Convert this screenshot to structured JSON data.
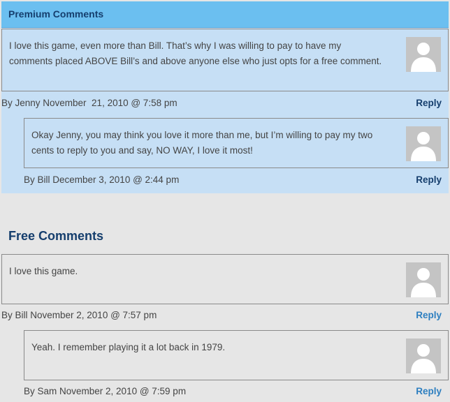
{
  "premium": {
    "title": "Premium Comments",
    "comments": [
      {
        "text": "I love this game, even more than Bill. That’s why I was willing to pay to have my comments placed ABOVE Bill’s and above anyone else who just opts for a free comment.",
        "meta": "By Jenny November  21, 2010 @ 7:58 pm",
        "reply": "Reply",
        "avatar_icon": "default-user-avatar"
      },
      {
        "text": "Okay Jenny, you may think you love it more than me, but I’m willing to pay my two cents to reply to you and say, NO WAY, I love it most!",
        "meta": "By Bill December 3, 2010 @ 2:44 pm",
        "reply": "Reply",
        "avatar_icon": "default-user-avatar"
      }
    ]
  },
  "free": {
    "title": "Free Comments",
    "comments": [
      {
        "text": "I love this game.",
        "meta": "By Bill November 2, 2010 @ 7:57 pm",
        "reply": "Reply",
        "avatar_icon": "default-user-avatar"
      },
      {
        "text": "Yeah. I remember playing it a lot back in 1979.",
        "meta": "By Sam November 2, 2010 @ 7:59 pm",
        "reply": "Reply",
        "avatar_icon": "default-user-avatar"
      }
    ]
  },
  "colors": {
    "header_bg": "#6bbff0",
    "premium_bg": "#c6dff5",
    "page_bg": "#e6e6e6",
    "title_color": "#153e6d",
    "free_reply_color": "#2d7fc0"
  }
}
